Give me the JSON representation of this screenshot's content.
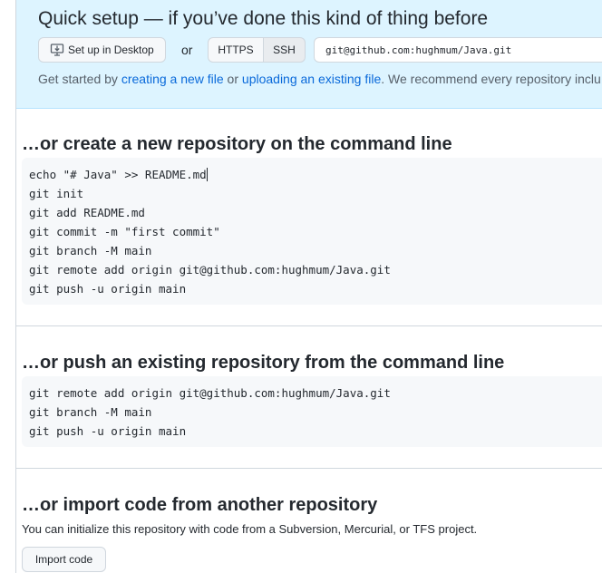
{
  "quick_setup": {
    "title": "Quick setup — if you’ve done this kind of thing before",
    "desktop_button": "Set up in Desktop",
    "or_text": "or",
    "https_label": "HTTPS",
    "ssh_label": "SSH",
    "clone_url": "git@github.com:hughmum/Java.git",
    "line_prefix": "Get started by ",
    "link_new_file": "creating a new file",
    "line_or": " or ",
    "link_upload": "uploading an existing file",
    "line_suffix": ". We recommend every repository inclu"
  },
  "create_section": {
    "title": "…or create a new repository on the command line",
    "lines": [
      "echo \"# Java\" >> README.md",
      "git init",
      "git add README.md",
      "git commit -m \"first commit\"",
      "git branch -M main",
      "git remote add origin git@github.com:hughmum/Java.git",
      "git push -u origin main"
    ]
  },
  "push_section": {
    "title": "…or push an existing repository from the command line",
    "lines": [
      "git remote add origin git@github.com:hughmum/Java.git",
      "git branch -M main",
      "git push -u origin main"
    ]
  },
  "import_section": {
    "title": "…or import code from another repository",
    "description": "You can initialize this repository with code from a Subversion, Mercurial, or TFS project.",
    "button": "Import code"
  }
}
